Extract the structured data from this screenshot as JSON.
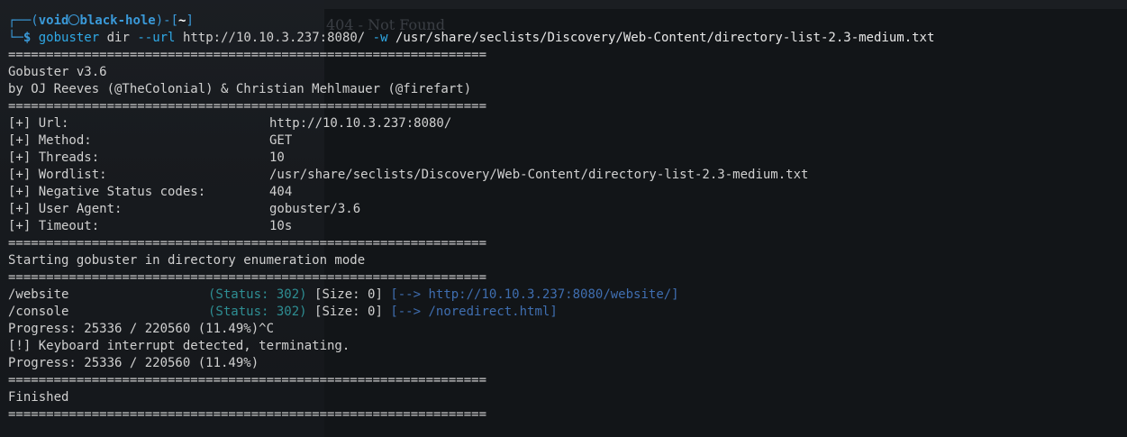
{
  "prompt": {
    "user": "void",
    "host": "black-hole",
    "cwd": "~",
    "symbol": "$"
  },
  "command": {
    "tool": "gobuster",
    "subcommand": "dir",
    "flag_url": "--url",
    "url": "http://10.10.3.237:8080/",
    "flag_wordlist": "-w",
    "wordlist": "/usr/share/seclists/Discovery/Web-Content/directory-list-2.3-medium.txt"
  },
  "separator": "===============================================================",
  "banner": {
    "title": "Gobuster v3.6",
    "authors": "by OJ Reeves (@TheColonial) & Christian Mehlmauer (@firefart)"
  },
  "config": [
    {
      "key": "[+] Url:",
      "value": "http://10.10.3.237:8080/"
    },
    {
      "key": "[+] Method:",
      "value": "GET"
    },
    {
      "key": "[+] Threads:",
      "value": "10"
    },
    {
      "key": "[+] Wordlist:",
      "value": "/usr/share/seclists/Discovery/Web-Content/directory-list-2.3-medium.txt"
    },
    {
      "key": "[+] Negative Status codes:",
      "value": "404"
    },
    {
      "key": "[+] User Agent:",
      "value": "gobuster/3.6"
    },
    {
      "key": "[+] Timeout:",
      "value": "10s"
    }
  ],
  "starting": "Starting gobuster in directory enumeration mode",
  "results": [
    {
      "path": "/website",
      "status": "(Status: 302)",
      "size": "[Size: 0]",
      "redirect": "[--> http://10.10.3.237:8080/website/]"
    },
    {
      "path": "/console",
      "status": "(Status: 302)",
      "size": "[Size: 0]",
      "redirect": "[--> /noredirect.html]"
    }
  ],
  "progress_1": "Progress: 25336 / 220560 (11.49%)^C",
  "interrupt": "[!] Keyboard interrupt detected, terminating.",
  "progress_2": "Progress: 25336 / 220560 (11.49%)",
  "finished": "Finished",
  "background": {
    "ghost_title": "404 - Not Found"
  }
}
